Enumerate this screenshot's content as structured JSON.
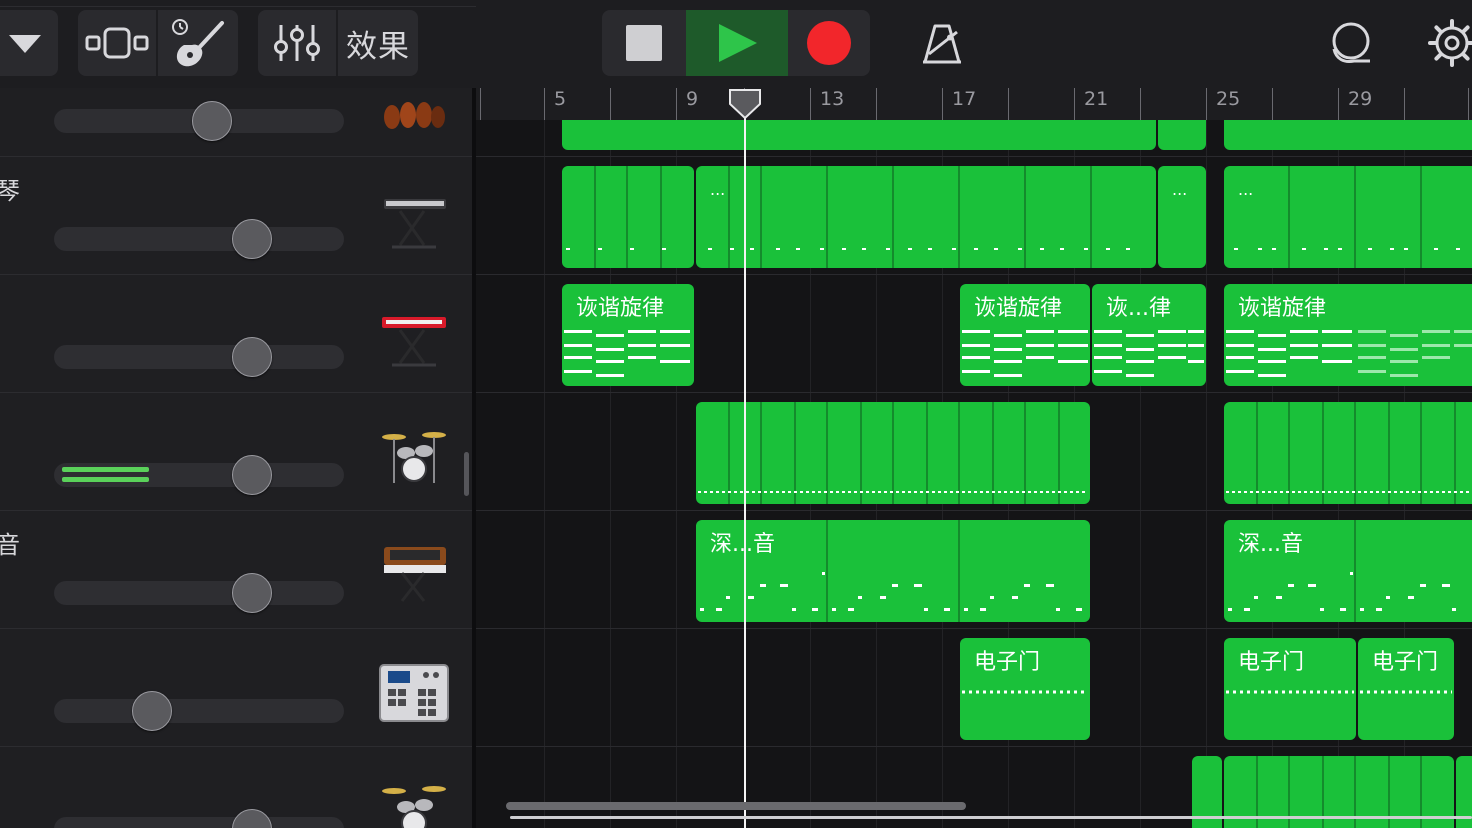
{
  "toolbar": {
    "fx_label": "效果",
    "transport": {
      "stop": "stop",
      "play": "play",
      "record": "record"
    },
    "colors": {
      "play_bg": "#1e5a2a",
      "play_icon": "#2ec54a",
      "record": "#f2262b",
      "group_bg": "#2a2a2e"
    }
  },
  "ruler": {
    "bars": [
      "5",
      "9",
      "13",
      "17",
      "21",
      "25",
      "29"
    ]
  },
  "tracks": [
    {
      "name": "",
      "icon": "orchestra-icon",
      "volume": 0.55,
      "meter": 0
    },
    {
      "name": "琴",
      "icon": "synth-keyboard-icon",
      "volume": 0.69,
      "meter": 0
    },
    {
      "name": "",
      "icon": "red-keyboard-icon",
      "volume": 0.69,
      "meter": 0
    },
    {
      "name": "",
      "icon": "drum-kit-icon",
      "volume": 0.69,
      "meter": 0.31
    },
    {
      "name": "音",
      "icon": "analog-synth-icon",
      "volume": 0.69,
      "meter": 0
    },
    {
      "name": "",
      "icon": "drum-machine-icon",
      "volume": 0.34,
      "meter": 0
    },
    {
      "name": "",
      "icon": "drum-kit-icon",
      "volume": 0.69,
      "meter": 0
    }
  ],
  "regions": {
    "r1": "诙谐旋律",
    "r2": "诙谐旋律",
    "r3": "诙...律",
    "r4": "诙谐旋律",
    "r5": "深...音",
    "r6": "深...音",
    "r7": "电子门",
    "r8": "电子门",
    "r9": "电子门",
    "ellipsis": "..."
  },
  "colors": {
    "region": "#1ac13a",
    "accent": "#5ad15a"
  }
}
